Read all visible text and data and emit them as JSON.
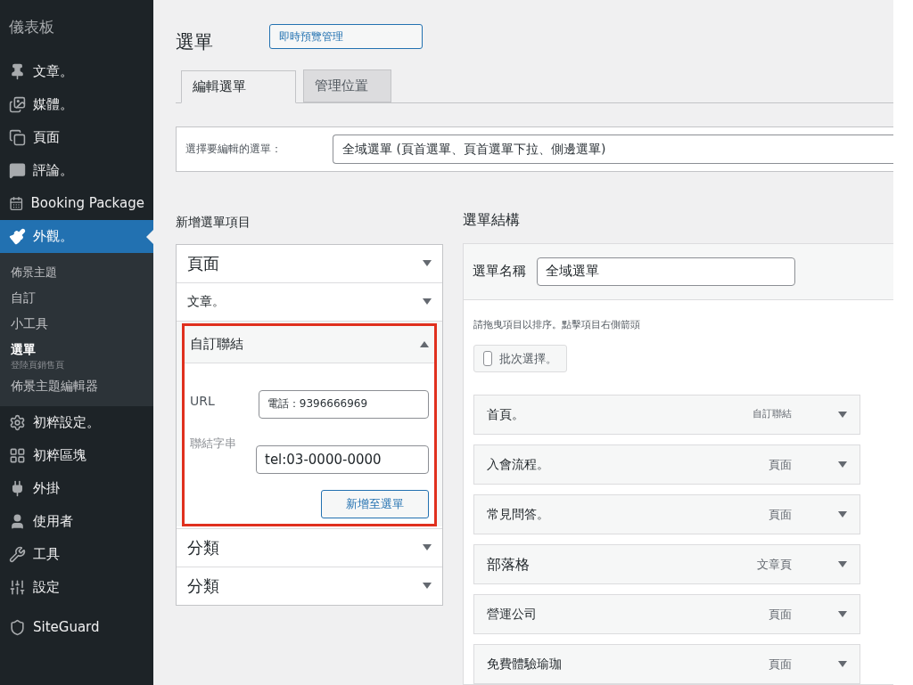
{
  "sidebar": {
    "top_label": "儀表板",
    "items": [
      {
        "label": "文章。",
        "selected": false
      },
      {
        "label": "媒體。",
        "selected": false
      },
      {
        "label": "頁面",
        "selected": false
      },
      {
        "label": "評論。",
        "selected": false
      },
      {
        "label": "Booking Package",
        "selected": false
      },
      {
        "label": "外觀。",
        "selected": true,
        "children": [
          {
            "label": "佈景主題",
            "selected": false
          },
          {
            "label": "自訂",
            "selected": false
          },
          {
            "label": "小工具",
            "selected": false
          },
          {
            "label": "選單",
            "selected": true,
            "note": "登陸頁銷售頁"
          },
          {
            "label": "佈景主題編輯器",
            "selected": false
          }
        ]
      },
      {
        "label": "初粹設定。",
        "selected": false
      },
      {
        "label": "初粹區塊",
        "selected": false
      },
      {
        "label": "外掛",
        "selected": false
      },
      {
        "label": "使用者",
        "selected": false
      },
      {
        "label": "工具",
        "selected": false
      },
      {
        "label": "設定",
        "selected": false
      },
      {
        "label": "SiteGuard",
        "selected": false
      }
    ]
  },
  "page": {
    "title": "選單",
    "preview_button": "即時預覽管理"
  },
  "tabs": [
    {
      "label": "編輯選單",
      "selected": true
    },
    {
      "label": "管理位置",
      "selected": false
    }
  ],
  "menu_select": {
    "label": "選擇要編輯的選單：",
    "value": "全域選單 (頁首選單、頁首選單下拉、側邊選單)"
  },
  "add_items": {
    "heading": "新增選單項目",
    "sections": [
      {
        "title": "頁面",
        "expanded": false,
        "highlighted": false
      },
      {
        "title": "文章。",
        "expanded": false,
        "highlighted": false
      },
      {
        "title": "自訂聯結",
        "expanded": true,
        "highlighted": true,
        "url_label": "URL",
        "url_value": "電話：9396666969",
        "text_label": "聯結字串",
        "text_value": "tel:03-0000-0000",
        "button": "新增至選單"
      },
      {
        "title": "分類",
        "expanded": false,
        "highlighted": false
      },
      {
        "title": "分類",
        "expanded": false,
        "highlighted": false
      }
    ]
  },
  "structure": {
    "heading": "選單結構",
    "name_label": "選單名稱",
    "name_value": "全域選單",
    "hint": "請拖曳項目以排序。點擊項目右側箭頭",
    "bulk_select": {
      "label": "批次選擇。",
      "checked": false
    },
    "items": [
      {
        "title": "首頁。",
        "type": "自訂聯結"
      },
      {
        "title": "入會流程。",
        "type": "頁面"
      },
      {
        "title": "常見問答。",
        "type": "頁面"
      },
      {
        "title": "部落格",
        "type": "文章頁"
      },
      {
        "title": "營運公司",
        "type": "頁面"
      },
      {
        "title": "免費體驗瑜珈",
        "type": "頁面"
      }
    ]
  }
}
